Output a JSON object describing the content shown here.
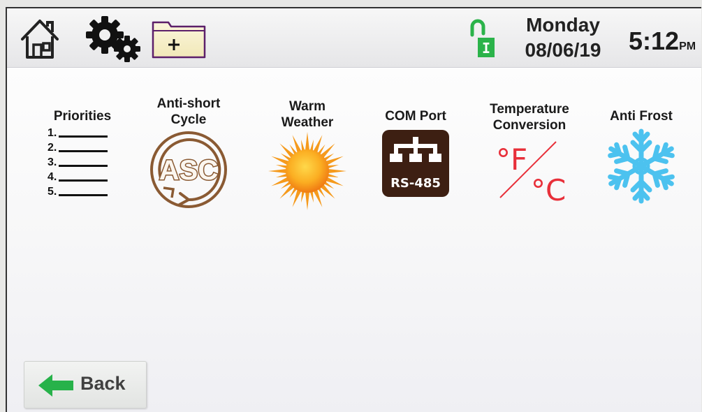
{
  "header": {
    "home_icon": "home-icon",
    "settings_icon": "gears-icon",
    "add_folder_icon": "folder-plus-icon",
    "lock_icon": "unlocked-padlock-icon",
    "lock_letter": "I",
    "day": "Monday",
    "date": "08/06/19",
    "time": "5:12",
    "ampm": "PM"
  },
  "tiles": [
    {
      "label": "Priorities",
      "icon": "priorities-list-icon",
      "items": [
        "1.",
        "2.",
        "3.",
        "4.",
        "5."
      ]
    },
    {
      "label": "Anti-short\nCycle",
      "icon": "asc-icon",
      "icon_text": "ASC"
    },
    {
      "label": "Warm\nWeather",
      "icon": "sun-icon"
    },
    {
      "label": "COM Port",
      "icon": "rs485-network-icon",
      "icon_text": "RS-485"
    },
    {
      "label": "Temperature\nConversion",
      "icon": "fahrenheit-celsius-icon",
      "icon_text_f": "°F",
      "icon_text_c": "°C"
    },
    {
      "label": "Anti Frost",
      "icon": "snowflake-icon"
    }
  ],
  "back": {
    "label": "Back",
    "icon": "back-arrow-icon"
  },
  "colors": {
    "asc_brown": "#8a5a33",
    "sun_orange": "#f59a1c",
    "com_port_bg": "#3d1f12",
    "temp_red": "#e8303a",
    "snow_blue": "#4cc2ef",
    "lock_green": "#2bb34a",
    "back_green": "#27b24a"
  }
}
